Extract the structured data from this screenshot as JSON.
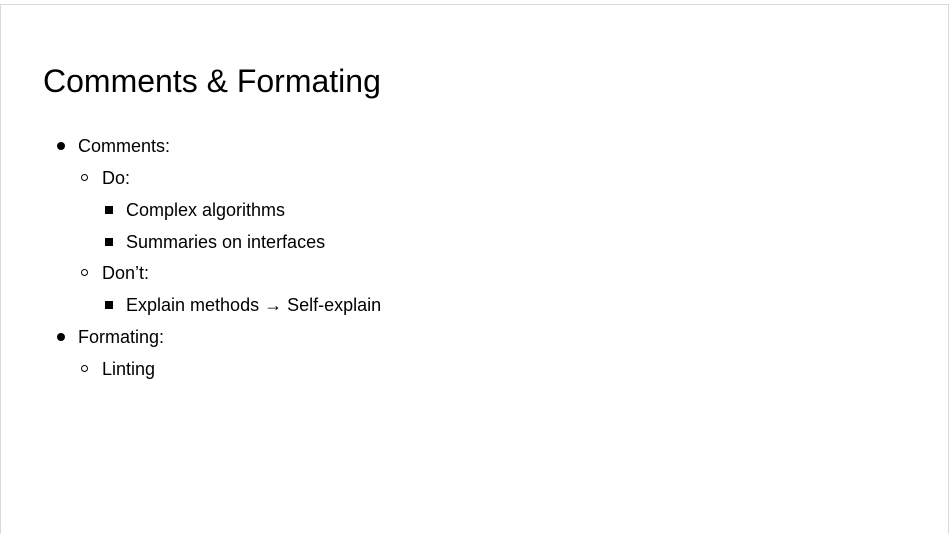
{
  "slide": {
    "title": "Comments & Formating",
    "bullets": [
      {
        "level": 1,
        "text": "Comments:"
      },
      {
        "level": 2,
        "text": "Do:"
      },
      {
        "level": 3,
        "text": "Complex algorithms"
      },
      {
        "level": 3,
        "text": "Summaries on interfaces"
      },
      {
        "level": 2,
        "text": "Don’t:"
      },
      {
        "level": 3,
        "text": "Explain methods → Self-explain"
      },
      {
        "level": 1,
        "text": "Formating:"
      },
      {
        "level": 2,
        "text": "Linting"
      }
    ]
  }
}
